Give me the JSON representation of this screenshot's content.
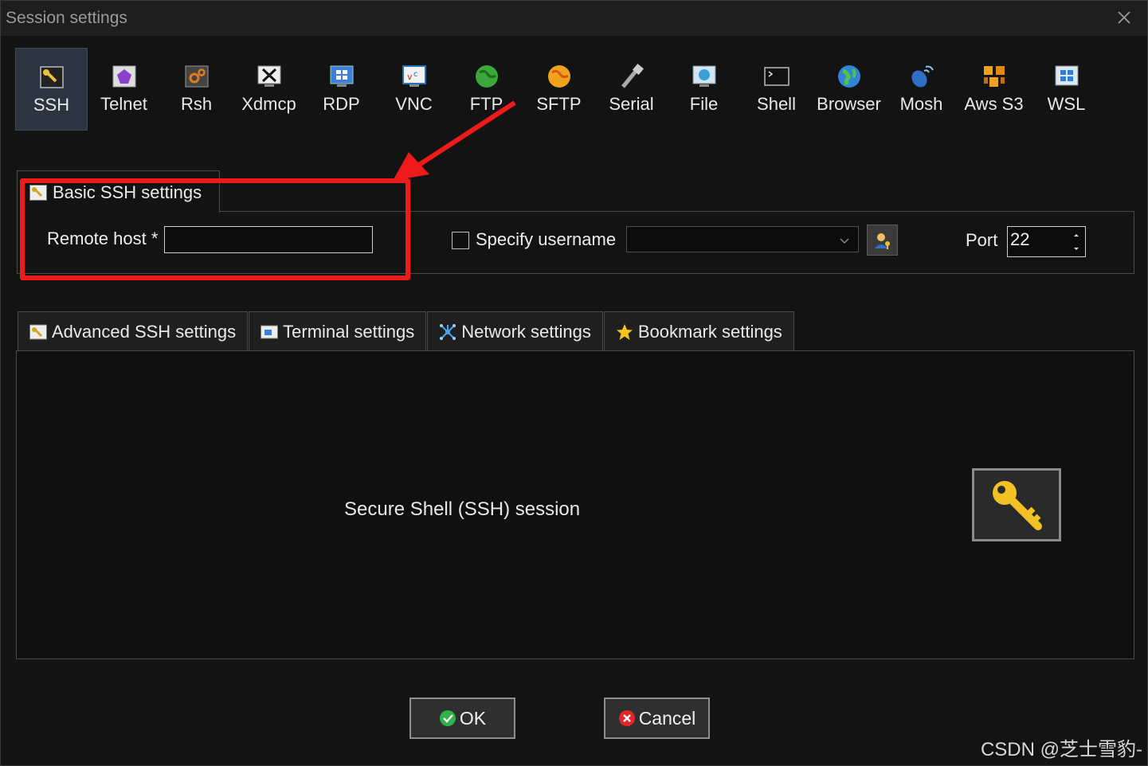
{
  "window": {
    "title": "Session settings"
  },
  "session_types": [
    {
      "label": "SSH",
      "icon": "ssh-icon",
      "active": true
    },
    {
      "label": "Telnet",
      "icon": "telnet-icon"
    },
    {
      "label": "Rsh",
      "icon": "rsh-icon"
    },
    {
      "label": "Xdmcp",
      "icon": "xdmcp-icon"
    },
    {
      "label": "RDP",
      "icon": "rdp-icon"
    },
    {
      "label": "VNC",
      "icon": "vnc-icon"
    },
    {
      "label": "FTP",
      "icon": "ftp-icon"
    },
    {
      "label": "SFTP",
      "icon": "sftp-icon"
    },
    {
      "label": "Serial",
      "icon": "serial-icon"
    },
    {
      "label": "File",
      "icon": "file-icon"
    },
    {
      "label": "Shell",
      "icon": "shell-icon"
    },
    {
      "label": "Browser",
      "icon": "browser-icon"
    },
    {
      "label": "Mosh",
      "icon": "mosh-icon"
    },
    {
      "label": "Aws S3",
      "icon": "aws-s3-icon"
    },
    {
      "label": "WSL",
      "icon": "wsl-icon"
    }
  ],
  "basic": {
    "tab_label": "Basic SSH settings",
    "remote_host_label": "Remote host *",
    "remote_host_value": "",
    "specify_username_label": "Specify username",
    "specify_username_checked": false,
    "username_value": "",
    "port_label": "Port",
    "port_value": "22"
  },
  "tabs": [
    {
      "label": "Advanced SSH settings",
      "icon": "wrench-icon"
    },
    {
      "label": "Terminal settings",
      "icon": "terminal-icon"
    },
    {
      "label": "Network settings",
      "icon": "network-icon"
    },
    {
      "label": "Bookmark settings",
      "icon": "star-icon"
    }
  ],
  "main": {
    "description": "Secure Shell (SSH) session"
  },
  "buttons": {
    "ok": "OK",
    "cancel": "Cancel"
  },
  "watermark": "CSDN @芝士雪豹-",
  "colors": {
    "annotation_red": "#ef1b1b",
    "active_bg": "#2b3541",
    "ok_green": "#2fb24a",
    "cancel_red": "#e3262a"
  }
}
